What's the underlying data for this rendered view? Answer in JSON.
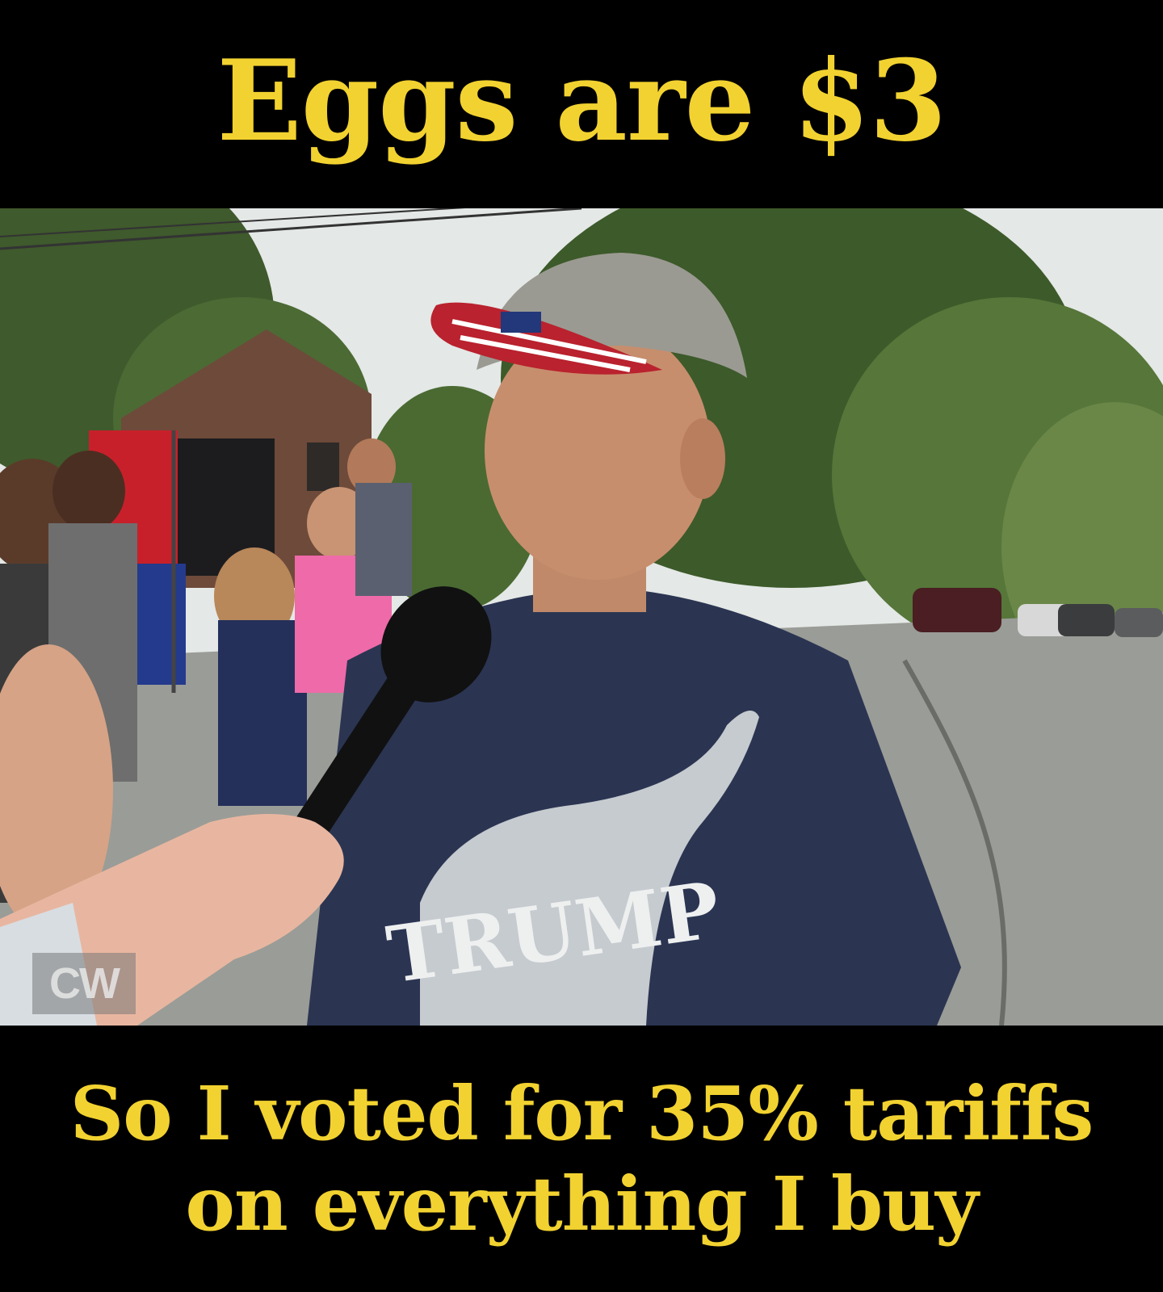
{
  "top_caption": "Eggs are $3",
  "bottom_caption": {
    "line1": "So I voted for 35% tariffs",
    "line2": "on everything I buy"
  },
  "photo": {
    "shirt_text": "TRUMP",
    "watermark": "CW"
  },
  "colors": {
    "caption_yellow": "#f2d230",
    "band_black": "#000000",
    "shirt_navy": "#2b3552"
  }
}
